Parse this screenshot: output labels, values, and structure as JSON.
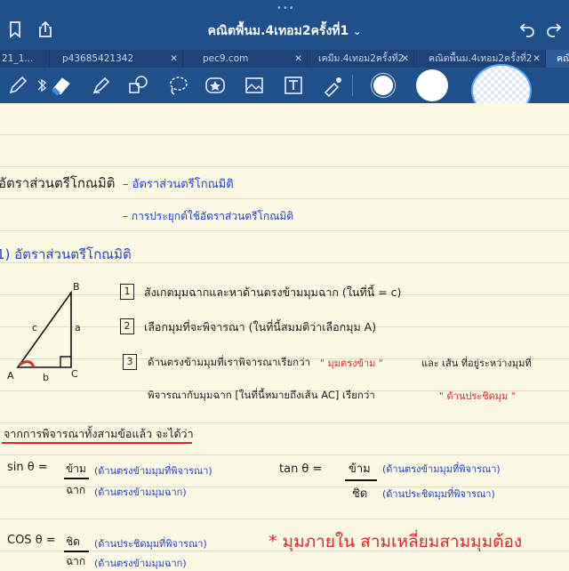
{
  "toolbar_top": {
    "title": "คณิตพื้นม.4เทอม2ครั้งที่1",
    "title_chevron": "⌄"
  },
  "tabs": [
    {
      "label": "21_1..."
    },
    {
      "label": "p43685421342"
    },
    {
      "label": "pec9.com"
    },
    {
      "label": "เคมีม.4เทอม2ครั้งที่2"
    },
    {
      "label": "คณิตพื้นม.4เทอม2ครั้งที่2"
    },
    {
      "label": "คณิ"
    }
  ],
  "tools": [
    "pen-icon",
    "bluetooth-icon",
    "eraser-icon",
    "highlighter-icon",
    "shapes-icon",
    "lasso-icon",
    "sticker-icon",
    "image-icon",
    "text-icon",
    "laser-pointer-icon"
  ],
  "notes": {
    "line1_title": "อัตราส่วนตรีโกณมิติ",
    "line1_item": "– อัตราส่วนตรีโกณมิติ",
    "line2_item": "– การประยุกต์ใช้อัตราส่วนตรีโกณมิติ",
    "section_title": "1) อัตราส่วนตรีโกณมิติ",
    "triangle": {
      "B": "B",
      "A": "A",
      "C": "C",
      "a": "a",
      "b": "b",
      "c": "c"
    },
    "step1_num": "1",
    "step1": "สังเกตมุมฉากและหาด้านตรงข้ามมุมฉาก (ในที่นี้ = c)",
    "step2_num": "2",
    "step2": "เลือกมุมที่จะพิจารณา (ในที่นี้สมมติว่าเลือกมุม A)",
    "step3_num": "3",
    "step3_a": "ด้านตรงข้ามมุมที่เราพิจารณาเรียกว่า",
    "step3_red1": "\" มุมตรงข้าม \"",
    "step3_b": "และ เส้น ที่อยู่ระหว่างมุมที่",
    "step3_c": "พิจารณากับมุมฉาก [ในที่นี้หมายถึงเส้น AC] เรียกว่า",
    "step3_red2": "\" ด้านประชิดมุม \"",
    "table_heading": "จากการพิจารณาทั้งสามข้อแล้ว จะได้ว่า",
    "sin_label": "sin θ =",
    "sin_num": "ข้าม",
    "sin_den": "ฉาก",
    "sin_num_note": "(ด้านตรงข้ามมุมที่พิจารณา)",
    "sin_den_note": "(ด้านตรงข้ามมุมฉาก)",
    "tan_label": "tan θ =",
    "tan_num": "ข้าม",
    "tan_den": "ชิด",
    "tan_num_note": "(ด้านตรงข้ามมุมที่พิจารณา)",
    "tan_den_note": "(ด้านประชิดมุมที่พิจารณา)",
    "cos_label": "COS θ =",
    "cos_num": "ชิด",
    "cos_den": "ฉาก",
    "cos_num_note": "(ด้านประชิดมุมที่พิจารณา)",
    "cos_den_note": "(ด้านตรงข้ามมุมฉาก)",
    "star_note": "* มุมภายใน สามเหลี่ยมสามมุมต้อง"
  },
  "colors": {
    "ink_blue": "#2540c8",
    "ink_red": "#e0262d",
    "ink_black": "#1b1b1b",
    "bar": "#20508a"
  }
}
